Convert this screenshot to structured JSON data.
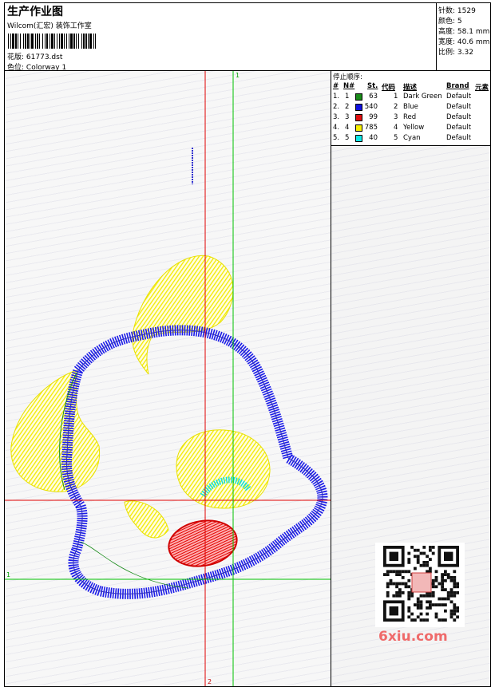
{
  "header": {
    "title": "生产作业图",
    "company": "Wilcom(汇宏) 装饰工作室",
    "pattern_label": "花版:",
    "pattern_value": "61773.dst",
    "colorway_label": "色位:",
    "colorway_value": "Colorway 1"
  },
  "stats": {
    "stitches_label": "针数:",
    "stitches_value": "1529",
    "colors_label": "颜色:",
    "colors_value": "5",
    "height_label": "高度:",
    "height_value": "58.1 mm",
    "width_label": "宽度:",
    "width_value": "40.6 mm",
    "scale_label": "比例:",
    "scale_value": "3.32"
  },
  "stop_sequence": {
    "title": "停止顺序:",
    "headers": [
      "#",
      "N#",
      "St.",
      "代码",
      "描述",
      "Brand",
      "元素"
    ],
    "rows": [
      {
        "idx": "1.",
        "n": "1",
        "st": "63",
        "code": "1",
        "desc": "Dark Green",
        "brand": "Default",
        "color": "#1a8c1a"
      },
      {
        "idx": "2.",
        "n": "2",
        "st": "540",
        "code": "2",
        "desc": "Blue",
        "brand": "Default",
        "color": "#1010e0"
      },
      {
        "idx": "3.",
        "n": "3",
        "st": "99",
        "code": "3",
        "desc": "Red",
        "brand": "Default",
        "color": "#e01010"
      },
      {
        "idx": "4.",
        "n": "4",
        "st": "785",
        "code": "4",
        "desc": "Yellow",
        "brand": "Default",
        "color": "#f8f000"
      },
      {
        "idx": "5.",
        "n": "5",
        "st": "40",
        "code": "5",
        "desc": "Cyan",
        "brand": "Default",
        "color": "#10e8e8"
      }
    ]
  },
  "canvas": {
    "axis_labels": {
      "top_green": "1",
      "left_green": "1",
      "bottom_red": "2"
    },
    "guide_colors": {
      "red": "#e00000",
      "green": "#00c000"
    }
  },
  "watermark": "6xiu.com"
}
